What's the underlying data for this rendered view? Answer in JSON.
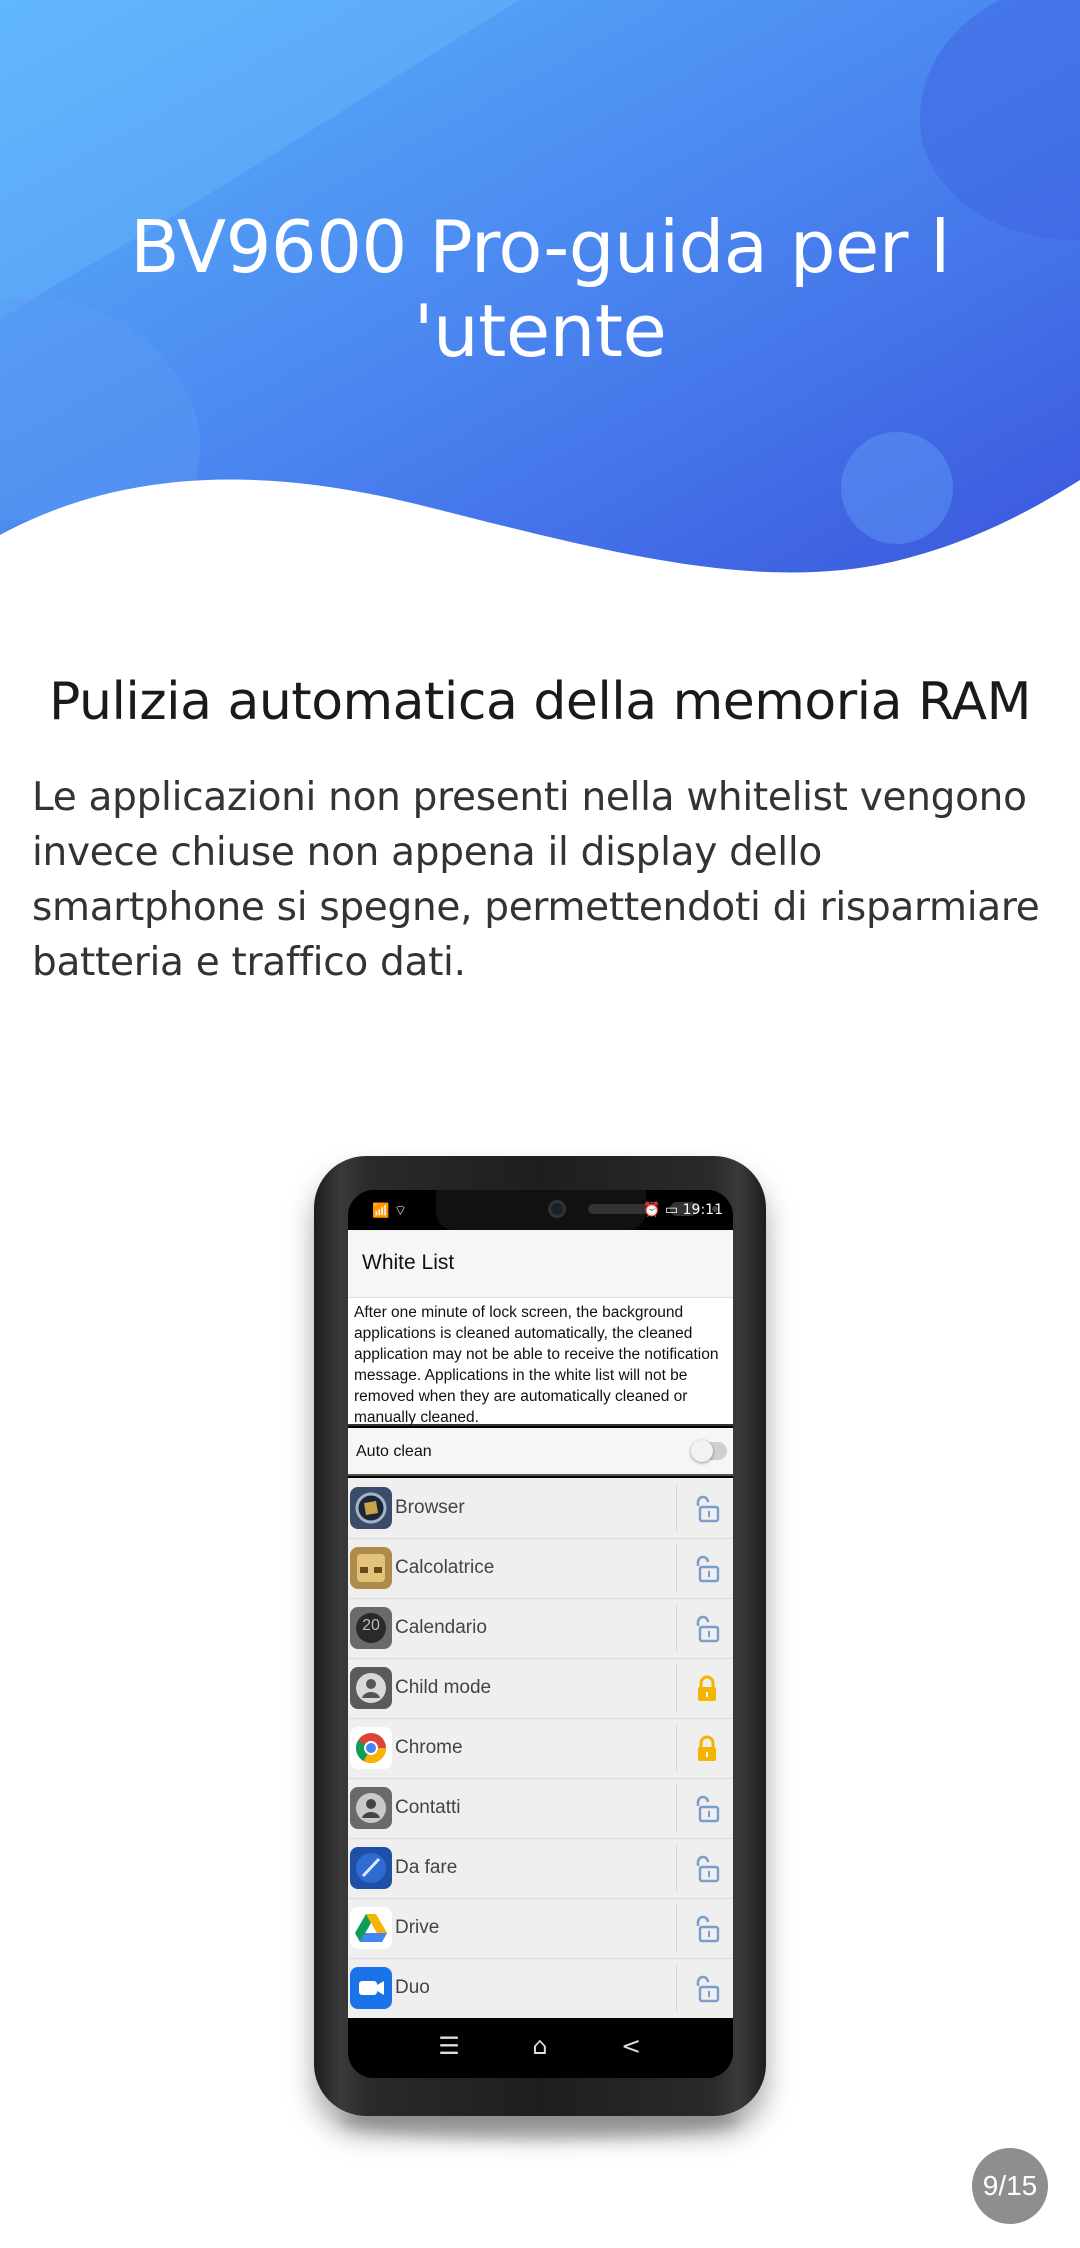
{
  "header": {
    "title": "BV9600 Pro-guida per l 'utente"
  },
  "section": {
    "title": "Pulizia automatica della memoria RAM",
    "body": "Le applicazioni non presenti nella whitelist vengono invece chiuse non appena il display dello smartphone si spegne, permettendoti di risparmiare batteria e traffico dati."
  },
  "phone": {
    "status": {
      "left": "📶 ⌔",
      "time": "⏰ ▭ 19:11"
    },
    "appbar_title": "White List",
    "info_text": "After one minute of lock screen, the background applications is cleaned automatically, the cleaned application may not be able to receive the notification message. Applications in the white list will not be removed when they are automatically cleaned or manually cleaned.",
    "auto_clean_label": "Auto clean",
    "auto_clean_on": false,
    "apps": [
      {
        "label": "Browser",
        "icon": "browser-icon",
        "locked": false
      },
      {
        "label": "Calcolatrice",
        "icon": "calculator-icon",
        "locked": false
      },
      {
        "label": "Calendario",
        "icon": "calendar-icon",
        "locked": false
      },
      {
        "label": "Child mode",
        "icon": "child-mode-icon",
        "locked": true
      },
      {
        "label": "Chrome",
        "icon": "chrome-icon",
        "locked": true
      },
      {
        "label": "Contatti",
        "icon": "contacts-icon",
        "locked": false
      },
      {
        "label": "Da fare",
        "icon": "todo-icon",
        "locked": false
      },
      {
        "label": "Drive",
        "icon": "drive-icon",
        "locked": false
      },
      {
        "label": "Duo",
        "icon": "duo-icon",
        "locked": false
      }
    ],
    "calendar_day": "20",
    "nav": {
      "menu": "☰",
      "home": "⌂",
      "back": "<"
    }
  },
  "page_indicator": "9/15",
  "colors": {
    "hero_light": "#4fa8f8",
    "hero_dark": "#3b5fe0",
    "lock_locked": "#f4b400",
    "lock_unlocked": "#7b9dc9"
  }
}
